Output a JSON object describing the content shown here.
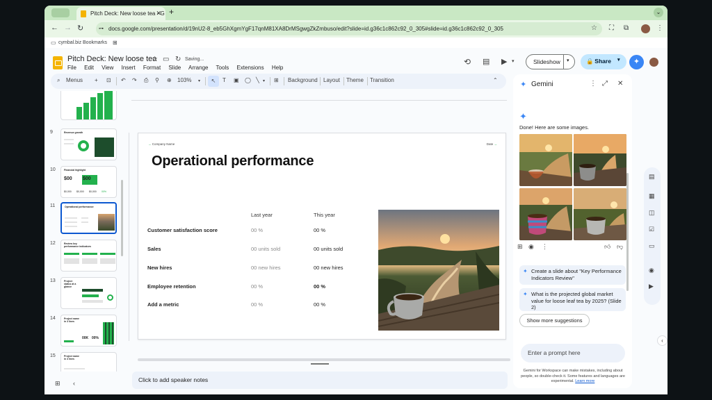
{
  "browser": {
    "tab_title": "Pitch Deck: New loose tea - G",
    "tab_close": "✕",
    "new_tab": "+",
    "url": "docs.google.com/presentation/d/19nU2-8_eb5GhXgmYgF17qnM81XA8DrMSgwgZkZmbuso/edit?slide=id.g36c1c862c92_0_305#slide=id.g36c1c862c92_0_305",
    "bookmark_label": "cymbal.biz Bookmarks"
  },
  "doc": {
    "title": "Pitch Deck: New loose tea",
    "saving": "Saving...",
    "menus": [
      "File",
      "Edit",
      "View",
      "Insert",
      "Format",
      "Slide",
      "Arrange",
      "Tools",
      "Extensions",
      "Help"
    ],
    "slideshow_label": "Slideshow",
    "share_label": "Share"
  },
  "toolbar": {
    "menus_label": "Menus",
    "zoom": "103%",
    "background": "Background",
    "layout": "Layout",
    "theme": "Theme",
    "transition": "Transition"
  },
  "filmstrip": {
    "slides": [
      {
        "num": "9",
        "title": "Revenue growth"
      },
      {
        "num": "10",
        "title": "Financial highlight",
        "values": [
          "$00",
          "$00"
        ],
        "sub": [
          "$0,000",
          "$0,000",
          "$0,000",
          "00%"
        ]
      },
      {
        "num": "11",
        "title": "Operational performance"
      },
      {
        "num": "12",
        "title": "Review key performance indicators"
      },
      {
        "num": "13",
        "title": "Project status at a glance"
      },
      {
        "num": "14",
        "title": "Project name in 3 lines",
        "values": [
          "00K",
          "00%"
        ]
      },
      {
        "num": "15",
        "title": "Project name in 3 lines"
      }
    ]
  },
  "slide": {
    "company": "Company Name",
    "date": "Date",
    "title": "Operational performance",
    "col_last": "Last year",
    "col_this": "This year",
    "rows": [
      {
        "label": "Customer satisfaction score",
        "last": "00 %",
        "this": "00 %"
      },
      {
        "label": "Sales",
        "last": "00 units sold",
        "this": "00 units sold"
      },
      {
        "label": "New hires",
        "last": "00 new hires",
        "this": "00 new hires"
      },
      {
        "label": "Employee retention",
        "last": "00 %",
        "this": "00 %"
      },
      {
        "label": "Add a metric",
        "last": "00 %",
        "this": "00 %"
      }
    ]
  },
  "notes_placeholder": "Click to add speaker notes",
  "gemini": {
    "title": "Gemini",
    "done_text": "Done! Here are some images.",
    "suggestions": [
      "Create a slide about \"Key Performance Indicators Review\"",
      "What is the projected global market value for loose leaf tea by 2025? (Slide 2)"
    ],
    "show_more": "Show more suggestions",
    "prompt_placeholder": "Enter a prompt here",
    "disclaimer": "Gemini for Workspace can make mistakes, including about people, so double-check it. Some features and languages are experimental.",
    "learn_more": "Learn more"
  },
  "colors": {
    "accent_green": "#23b14d",
    "gemini_blue": "#3a86f5",
    "share_bg": "#c2e7ff",
    "chrome_tab": "#c9e8c4"
  }
}
